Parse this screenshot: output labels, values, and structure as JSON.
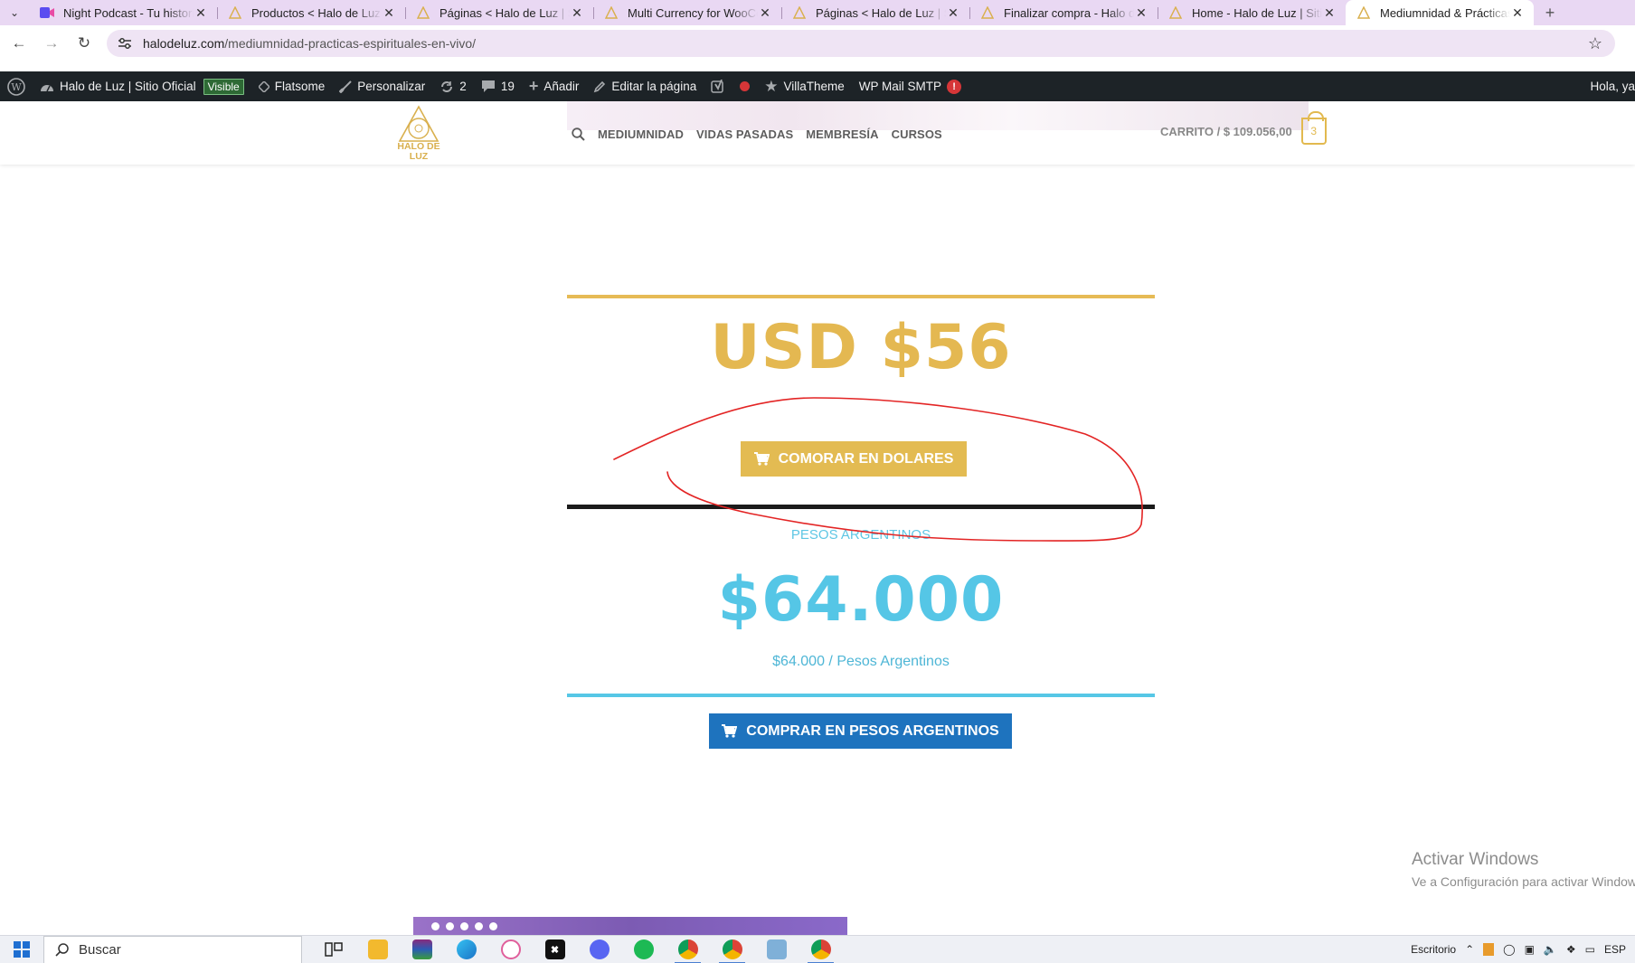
{
  "browser": {
    "tabs": [
      {
        "title": "Night Podcast - Tu historia",
        "favicon": "video-icon",
        "active": false
      },
      {
        "title": "Productos < Halo de Luz | Sitio",
        "favicon": "halo-icon",
        "active": false
      },
      {
        "title": "Páginas < Halo de Luz | Sitio",
        "favicon": "halo-icon",
        "active": false
      },
      {
        "title": "Multi Currency for WooCommerce",
        "favicon": "halo-icon",
        "active": false
      },
      {
        "title": "Páginas < Halo de Luz | Sitio",
        "favicon": "halo-icon",
        "active": false
      },
      {
        "title": "Finalizar compra - Halo de Luz",
        "favicon": "halo-icon",
        "active": false
      },
      {
        "title": "Home - Halo de Luz | Sitio",
        "favicon": "halo-icon",
        "active": false
      },
      {
        "title": "Mediumnidad & Prácticas",
        "favicon": "halo-icon",
        "active": true
      }
    ],
    "url_domain": "halodeluz.com",
    "url_path": "/mediumnidad-practicas-espirituales-en-vivo/"
  },
  "adminbar": {
    "site_name": "Halo de Luz | Sitio Oficial",
    "visible_badge": "Visible",
    "theme": "Flatsome",
    "customize": "Personalizar",
    "updates_count": "2",
    "comments_count": "19",
    "add_new": "Añadir",
    "edit_page": "Editar la página",
    "villatheme": "VillaTheme",
    "wp_mail_smtp": "WP Mail SMTP",
    "smtp_alert": "!",
    "greeting": "Hola, ya"
  },
  "header": {
    "logo_text_line1": "HALO DE",
    "logo_text_line2": "LUZ",
    "nav": [
      "MEDIUMNIDAD",
      "VIDAS PASADAS",
      "MEMBRESÍA",
      "CURSOS"
    ],
    "cart_label": "CARRITO / $ 109.056,00",
    "cart_count": "3"
  },
  "pricing": {
    "usd_price": "USD $56",
    "usd_button": "COMORAR EN DOLARES",
    "ars_label": "PESOS ARGENTINOS",
    "ars_price": "$64.000",
    "ars_subtext": "$64.000 / Pesos Argentinos",
    "ars_button": "COMPRAR EN PESOS ARGENTINOS"
  },
  "watermark": {
    "title": "Activar Windows",
    "subtitle": "Ve a Configuración para activar Windows."
  },
  "taskbar": {
    "search_placeholder": "Buscar",
    "apps": [
      "task-view",
      "file-explorer",
      "winrar",
      "edge",
      "snipping-tool",
      "capcut",
      "discord",
      "spotify",
      "chrome-profile-1",
      "chrome-profile-2",
      "notepad-app",
      "chrome-profile-3"
    ],
    "desktop_label": "Escritorio",
    "language": "ESP"
  },
  "colors": {
    "gold": "#e4b851",
    "cyan": "#55c6e6",
    "blue_button": "#1e73be",
    "admin_bar": "#1d2327",
    "annotation_red": "#e32424"
  }
}
